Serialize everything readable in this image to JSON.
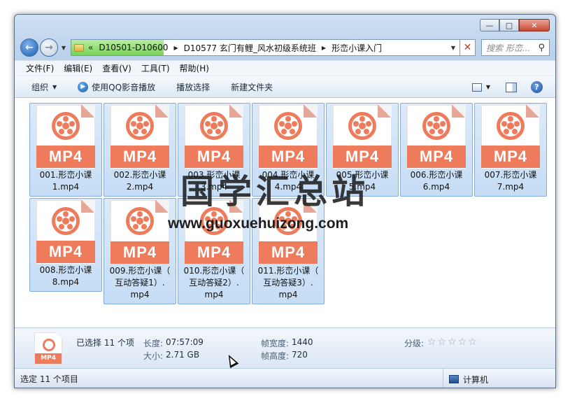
{
  "titlebar": {
    "caption_buttons": {
      "minimize": "—",
      "maximize": "□",
      "close": "✕"
    }
  },
  "address": {
    "prefix": "«",
    "crumbs": [
      "D10501-D10600",
      "D10577 玄门有鲤_风水初级系统班",
      "形峦小课入门"
    ],
    "search_placeholder": "搜索 形峦...",
    "progress_color": "#7ad05a"
  },
  "menu": [
    "文件(F)",
    "编辑(E)",
    "查看(V)",
    "工具(T)",
    "帮助(H)"
  ],
  "toolbar": {
    "organize": "组织",
    "play_qq": "使用QQ影音播放",
    "play_selection": "播放选择",
    "new_folder": "新建文件夹"
  },
  "icon_badge": "MP4",
  "icon_badge_small": "MP4",
  "accent_color": "#ee7b5c",
  "files": [
    {
      "line1": "001.形峦小课",
      "line2": "1.mp4"
    },
    {
      "line1": "002.形峦小课",
      "line2": "2.mp4"
    },
    {
      "line1": "003.形峦小课",
      "line2": "3.mp4"
    },
    {
      "line1": "004.形峦小课",
      "line2": "4.mp4"
    },
    {
      "line1": "005.形峦小课",
      "line2": "5.mp4"
    },
    {
      "line1": "006.形峦小课",
      "line2": "6.mp4"
    },
    {
      "line1": "007.形峦小课",
      "line2": "7.mp4"
    },
    {
      "line1": "008.形峦小课",
      "line2": "8.mp4"
    },
    {
      "line1": "009.形峦小课（",
      "line2": "互动答疑1）.",
      "line3": "mp4"
    },
    {
      "line1": "010.形峦小课（",
      "line2": "互动答疑2）.",
      "line3": "mp4"
    },
    {
      "line1": "011.形峦小课（",
      "line2": "互动答疑3）.",
      "line3": "mp4"
    }
  ],
  "watermark": {
    "title": "国学汇总站",
    "url": "www.guoxuehuizong.com"
  },
  "details": {
    "selected": "已选择 11 个项",
    "length_key": "长度:",
    "length_val": "07:57:09",
    "size_key": "大小:",
    "size_val": "2.71 GB",
    "frame_width_key": "帧宽度:",
    "frame_width_val": "1440",
    "frame_height_key": "帧高度:",
    "frame_height_val": "720",
    "rating_key": "分级:",
    "stars": "☆☆☆☆☆"
  },
  "status": {
    "left": "选定 11 个项目",
    "right": "计算机"
  }
}
